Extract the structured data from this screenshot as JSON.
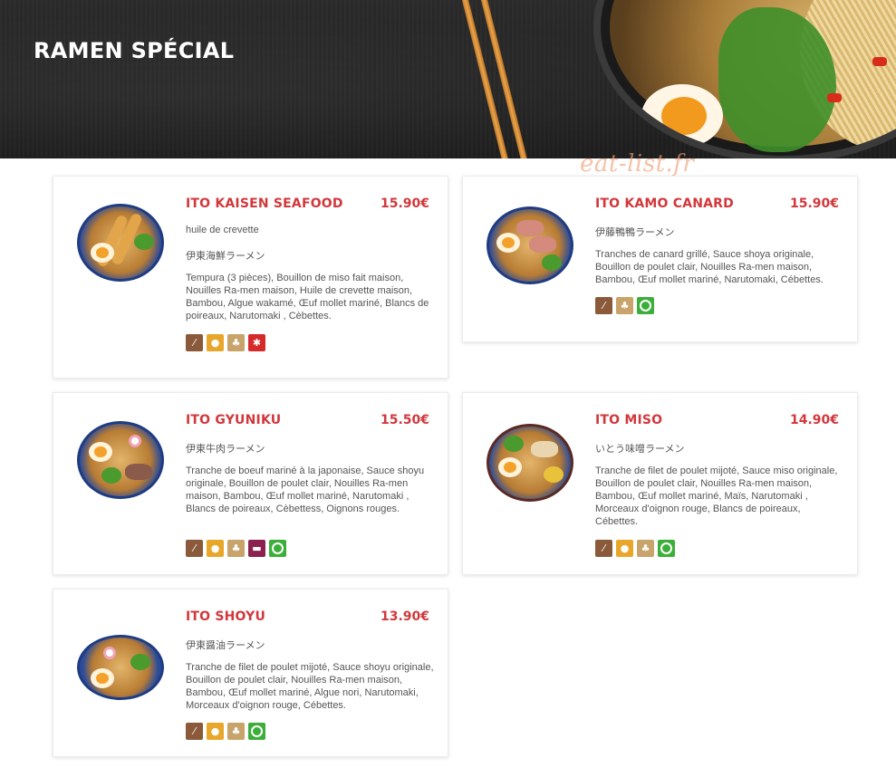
{
  "header": {
    "title": "RAMEN SPÉCIAL"
  },
  "watermark": "eat-list.fr",
  "items": [
    {
      "name": "ITO KAISEN SEAFOOD",
      "price": "15.90€",
      "sub1": "huile de crevette",
      "sub2": "伊東海鮮ラーメン",
      "desc": "Tempura (3 pièces), Bouillon de miso fait maison, Nouilles Ra-men maison, Huile de crevette maison, Bambou, Algue wakamé, Œuf mollet mariné, Blancs de poireaux, Narutomaki , Cèbettes.",
      "allergens": [
        "gluten-icon",
        "egg-icon",
        "nuts-icon",
        "crustacean-icon"
      ]
    },
    {
      "name": "ITO KAMO CANARD",
      "price": "15.90€",
      "sub1": "伊藤鴨鴨ラーメン",
      "desc": "Tranches de canard grillé, Sauce shoya originale, Bouillon de poulet clair, Nouilles Ra-men maison, Bambou, Œuf mollet mariné, Narutomaki, Cébettes.",
      "allergens": [
        "gluten-icon",
        "nuts-icon",
        "vegetal-icon"
      ]
    },
    {
      "name": "ITO GYUNIKU",
      "price": "15.50€",
      "sub1": "伊東牛肉ラーメン",
      "desc": "Tranche de boeuf mariné à la japonaise, Sauce shoyu originale, Bouillon de poulet clair, Nouilles Ra-men maison, Bambou, Œuf mollet mariné, Narutomaki , Blancs de poireaux, Cèbettess, Oignons rouges.",
      "allergens": [
        "gluten-icon",
        "egg-icon",
        "nuts-icon",
        "beef-icon",
        "vegetal-icon"
      ]
    },
    {
      "name": "ITO MISO",
      "price": "14.90€",
      "sub1": "いとう味噌ラーメン",
      "desc": "Tranche de filet de poulet mijoté, Sauce miso originale, Bouillon de poulet clair, Nouilles Ra-men maison, Bambou, Œuf mollet mariné, Maïs, Narutomaki , Morceaux d'oignon rouge, Blancs de poireaux, Cébettes.",
      "allergens": [
        "gluten-icon",
        "egg-icon",
        "nuts-icon",
        "vegetal-icon"
      ]
    },
    {
      "name": "ITO SHOYU",
      "price": "13.90€",
      "sub1": "伊東醤油ラーメン",
      "desc": "Tranche de filet de poulet mijoté, Sauce shoyu originale, Bouillon de poulet clair, Nouilles Ra-men maison, Bambou, Œuf mollet mariné, Algue nori, Narutomaki, Morceaux d'oignon rouge, Cébettes.",
      "allergens": [
        "gluten-icon",
        "egg-icon",
        "nuts-icon",
        "vegetal-icon"
      ]
    }
  ]
}
